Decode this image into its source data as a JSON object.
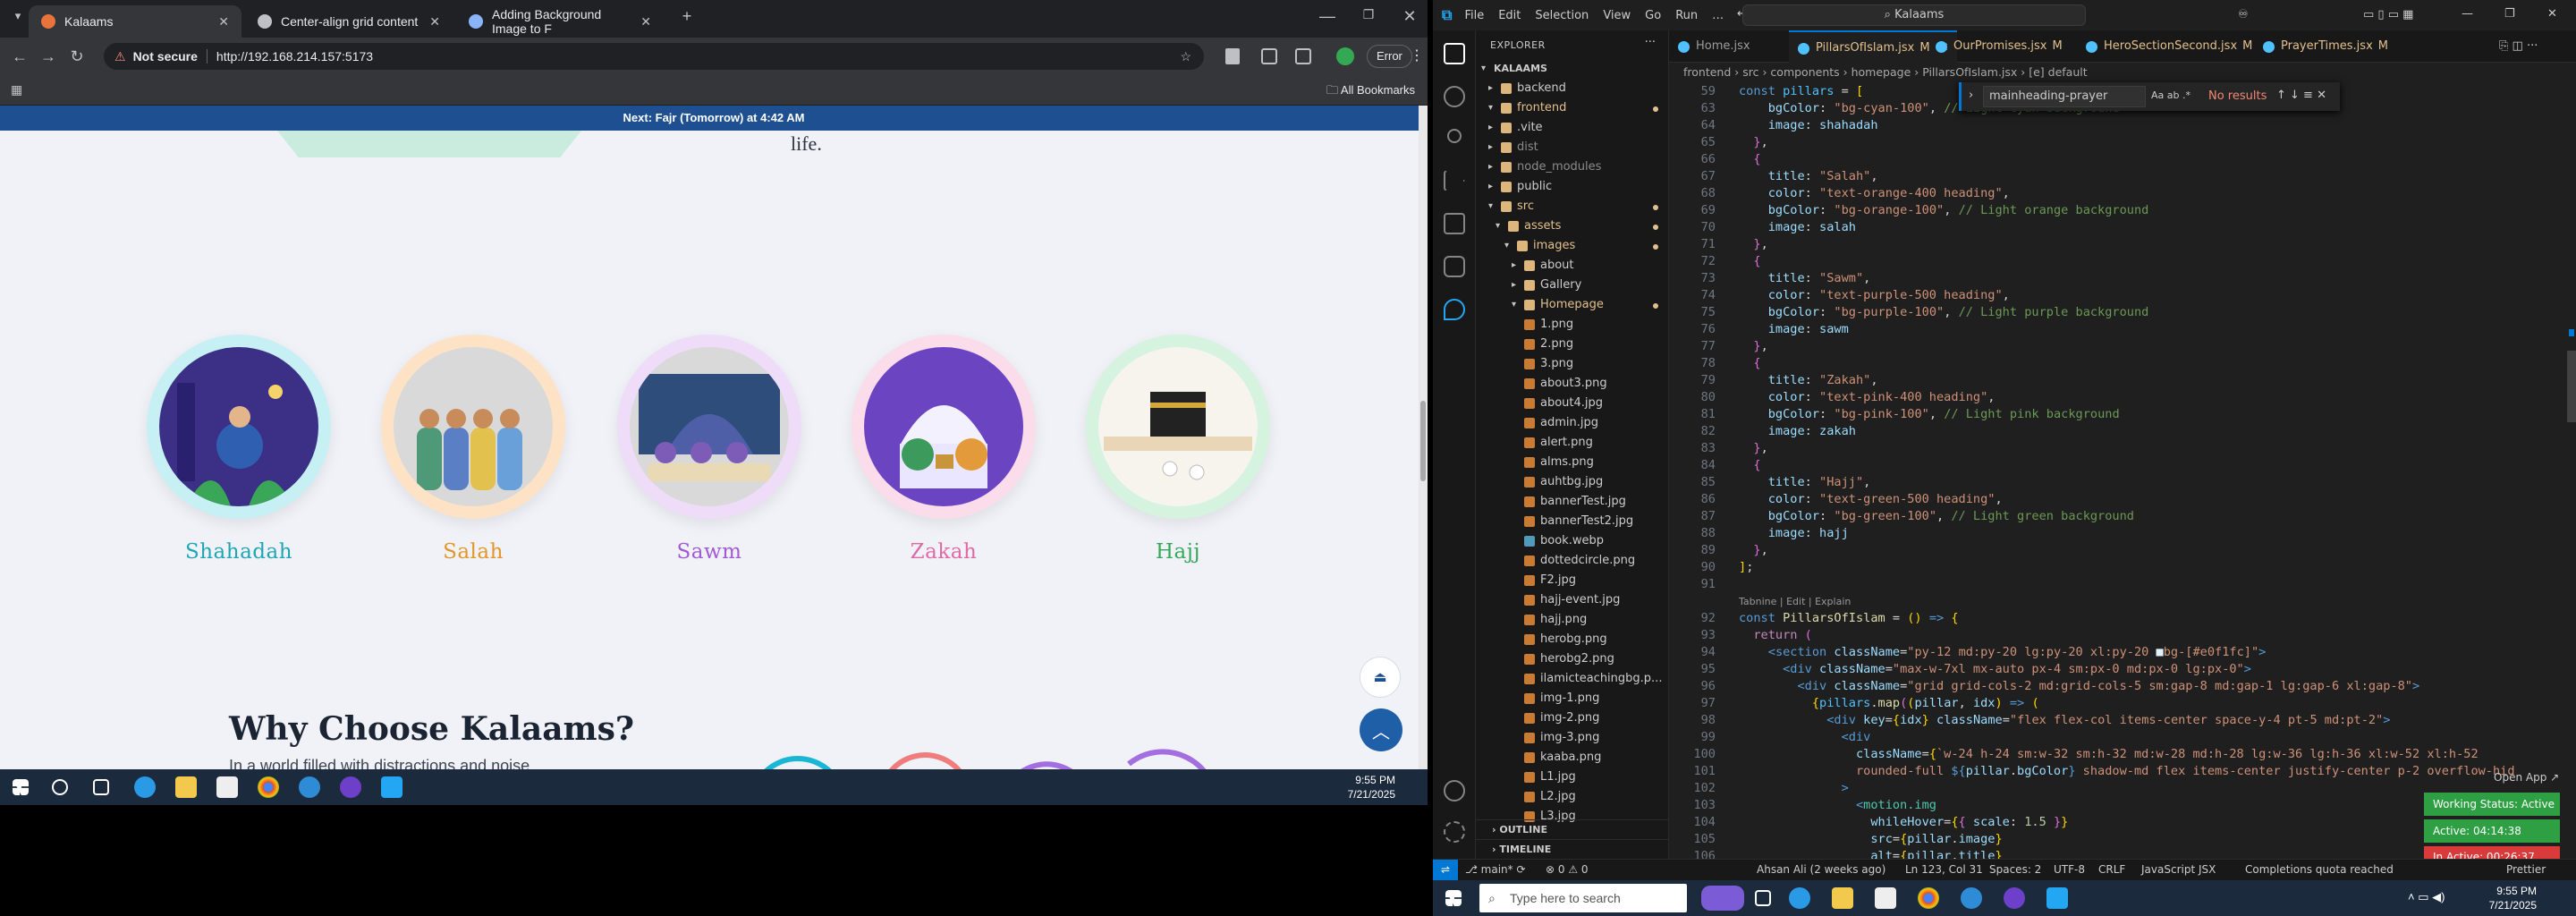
{
  "browser": {
    "tabs": [
      {
        "title": "Kalaams",
        "active": true
      },
      {
        "title": "Center-align grid content",
        "active": false
      },
      {
        "title": "Adding Background Image to F",
        "active": false
      }
    ],
    "omnibox": {
      "security": "Not secure",
      "url": "http://192.168.214.157:5173"
    },
    "error_label": "Error",
    "bookmarks_label": "All Bookmarks"
  },
  "site": {
    "prayer_notice": "Next: Fajr (Tomorrow) at 4:42 AM",
    "life_text": "life.",
    "pillars": [
      {
        "name": "Shahadah",
        "color": "#1fa6b5",
        "ring": "#c7f0f5"
      },
      {
        "name": "Salah",
        "color": "#e2962b",
        "ring": "#fde2c6"
      },
      {
        "name": "Sawm",
        "color": "#a15ad6",
        "ring": "#eedcf8"
      },
      {
        "name": "Zakah",
        "color": "#e06aa8",
        "ring": "#fbdcea"
      },
      {
        "name": "Hajj",
        "color": "#36a85b",
        "ring": "#d5f3de"
      }
    ],
    "why_title": "Why Choose Kalaams?",
    "why_sub": "In a world filled with distractions and noise,"
  },
  "taskbar_left": {
    "time": "9:55 PM",
    "date": "7/21/2025"
  },
  "vscode": {
    "menu": [
      "File",
      "Edit",
      "Selection",
      "View",
      "Go",
      "Run",
      "…"
    ],
    "search": "Kalaams",
    "explorer_title": "EXPLORER",
    "tree": [
      {
        "label": "KALAAMS",
        "level": 0,
        "type": "root"
      },
      {
        "label": "backend",
        "level": 1,
        "type": "folder",
        "open": false
      },
      {
        "label": "frontend",
        "level": 1,
        "type": "folder",
        "open": true,
        "mod": true
      },
      {
        "label": ".vite",
        "level": 2,
        "type": "folder"
      },
      {
        "label": "dist",
        "level": 2,
        "type": "folder"
      },
      {
        "label": "node_modules",
        "level": 2,
        "type": "folder"
      },
      {
        "label": "public",
        "level": 2,
        "type": "folder"
      },
      {
        "label": "src",
        "level": 2,
        "type": "folder",
        "open": true,
        "mod": true
      },
      {
        "label": "assets",
        "level": 3,
        "type": "folder",
        "open": true,
        "mod": true
      },
      {
        "label": "images",
        "level": 4,
        "type": "folder",
        "open": true,
        "mod": true
      },
      {
        "label": "about",
        "level": 5,
        "type": "folder"
      },
      {
        "label": "Gallery",
        "level": 5,
        "type": "folder"
      },
      {
        "label": "Homepage",
        "level": 5,
        "type": "folder",
        "open": true,
        "mod": true
      },
      {
        "label": "1.png",
        "level": 6,
        "type": "img"
      },
      {
        "label": "2.png",
        "level": 6,
        "type": "img"
      },
      {
        "label": "3.png",
        "level": 6,
        "type": "img"
      },
      {
        "label": "about3.png",
        "level": 6,
        "type": "img"
      },
      {
        "label": "about4.jpg",
        "level": 6,
        "type": "img"
      },
      {
        "label": "admin.jpg",
        "level": 6,
        "type": "img"
      },
      {
        "label": "alert.png",
        "level": 6,
        "type": "img"
      },
      {
        "label": "alms.png",
        "level": 6,
        "type": "img"
      },
      {
        "label": "auhtbg.jpg",
        "level": 6,
        "type": "img"
      },
      {
        "label": "bannerTest.jpg",
        "level": 6,
        "type": "img"
      },
      {
        "label": "bannerTest2.jpg",
        "level": 6,
        "type": "img"
      },
      {
        "label": "book.webp",
        "level": 6,
        "type": "img2"
      },
      {
        "label": "dottedcircle.png",
        "level": 6,
        "type": "img"
      },
      {
        "label": "F2.jpg",
        "level": 6,
        "type": "img"
      },
      {
        "label": "hajj-event.jpg",
        "level": 6,
        "type": "img"
      },
      {
        "label": "hajj.png",
        "level": 6,
        "type": "img"
      },
      {
        "label": "herobg.png",
        "level": 6,
        "type": "img"
      },
      {
        "label": "herobg2.png",
        "level": 6,
        "type": "img"
      },
      {
        "label": "ilamicteachingbg.p...",
        "level": 6,
        "type": "img"
      },
      {
        "label": "img-1.png",
        "level": 6,
        "type": "img"
      },
      {
        "label": "img-2.png",
        "level": 6,
        "type": "img"
      },
      {
        "label": "img-3.png",
        "level": 6,
        "type": "img"
      },
      {
        "label": "kaaba.png",
        "level": 6,
        "type": "img"
      },
      {
        "label": "L1.jpg",
        "level": 6,
        "type": "img"
      },
      {
        "label": "L2.jpg",
        "level": 6,
        "type": "img"
      },
      {
        "label": "L3.jpg",
        "level": 6,
        "type": "img"
      }
    ],
    "outline": "OUTLINE",
    "timeline": "TIMELINE",
    "editor_tabs": [
      {
        "label": "Home.jsx",
        "mod": "",
        "active": false
      },
      {
        "label": "PillarsOfIslam.jsx",
        "mod": "M",
        "active": true
      },
      {
        "label": "OurPromises.jsx",
        "mod": "M",
        "active": false
      },
      {
        "label": "HeroSectionSecond.jsx",
        "mod": "M",
        "active": false
      },
      {
        "label": "PrayerTimes.jsx",
        "mod": "M",
        "active": false
      }
    ],
    "breadcrumb": "frontend › src › components › homepage › PillarsOfIslam.jsx › [e] default",
    "find": {
      "query": "mainheading-prayer",
      "result": "No results"
    },
    "codelens": "Tabnine | Edit | Explain",
    "open_app": "Open App ↗",
    "status": {
      "branch": "main*",
      "problems": "⊗ 0 ⚠ 0",
      "blame": "Ahsan Ali (2 weeks ago)",
      "position": "Ln 123, Col 31",
      "spaces": "Spaces: 2",
      "encoding": "UTF-8",
      "eol": "CRLF",
      "language": "JavaScript JSX",
      "tabnine": "Completions quota reached",
      "prettier": "Prettier"
    },
    "working": {
      "status": "Working Status: Active",
      "active": "Active: 04:14:38",
      "inactive": "In Active: 00:26:37"
    }
  },
  "taskbar_right": {
    "search_placeholder": "Type here to search",
    "time": "9:55 PM",
    "date": "7/21/2025"
  }
}
